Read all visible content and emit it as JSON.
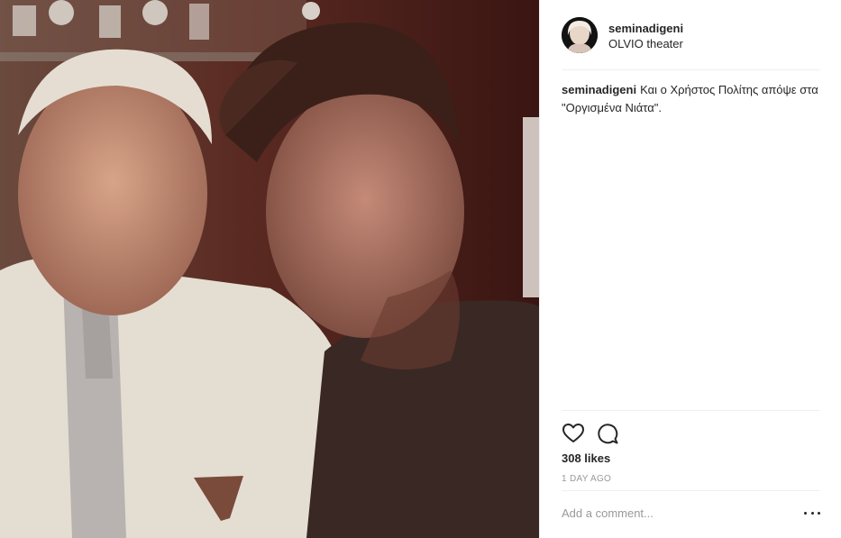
{
  "photo": {
    "alt": "Two men posing together"
  },
  "post": {
    "username": "seminadigeni",
    "location": "OLVIO theater",
    "caption_user": "seminadigeni",
    "caption_text": "Και ο Χρήστος Πολίτης απόψε στα \"Οργισμένα Νιάτα\".",
    "likes": "308 likes",
    "time": "1 DAY AGO"
  },
  "comment": {
    "placeholder": "Add a comment..."
  },
  "icons": {
    "like": "heart-icon",
    "comment": "speech-bubble-icon",
    "more": "more-options-icon"
  },
  "colors": {
    "text": "#262626",
    "muted": "#999999",
    "divider": "#efefef"
  }
}
